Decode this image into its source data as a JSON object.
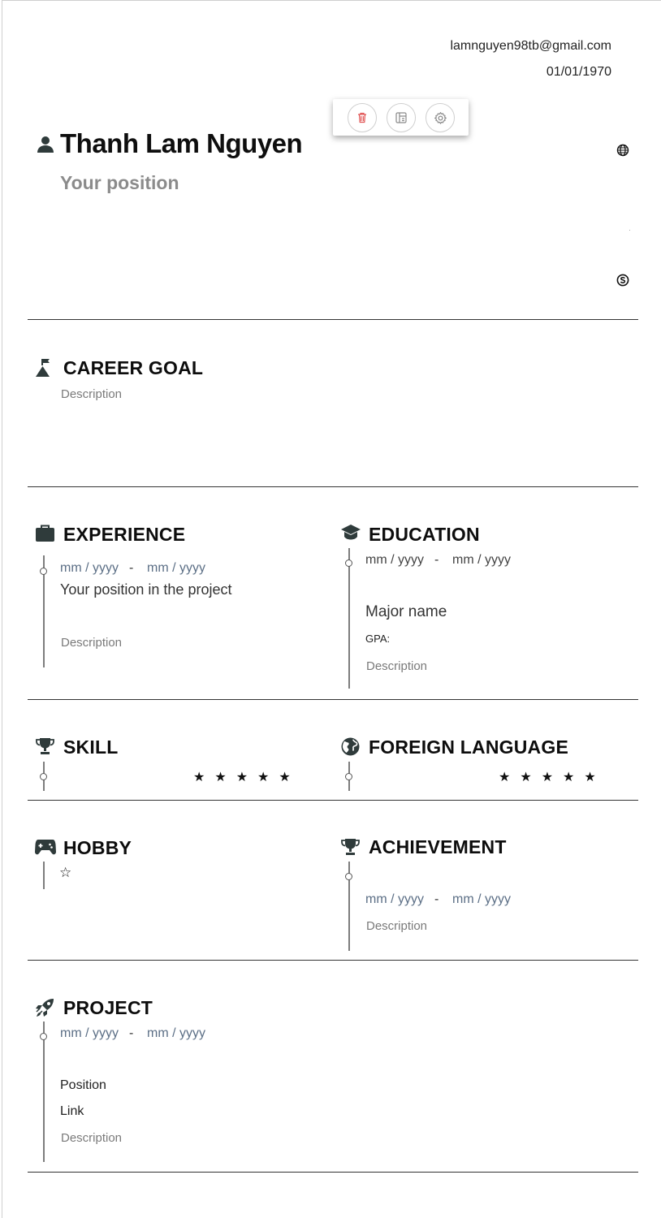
{
  "contact": {
    "email": "lamnguyen98tb@gmail.com",
    "birthday": "01/01/1970"
  },
  "profile": {
    "name": "Thanh Lam Nguyen",
    "position": "Your position"
  },
  "toolbar": {
    "icons": [
      "trash-icon",
      "layout-icon",
      "settings-icon"
    ],
    "delete_color": "#e05252"
  },
  "sections": {
    "career_goal": {
      "title": "CAREER GOAL",
      "description": "Description"
    },
    "experience": {
      "title": "EXPERIENCE",
      "start": "mm / yyyy",
      "separator": "-",
      "end": "mm / yyyy",
      "position": "Your position in the project",
      "description": "Description"
    },
    "education": {
      "title": "EDUCATION",
      "start": "mm / yyyy",
      "separator": "-",
      "end": "mm / yyyy",
      "major": "Major name",
      "gpa": "GPA:",
      "description": "Description"
    },
    "skill": {
      "title": "SKILL",
      "stars": "★★★★★"
    },
    "foreign_language": {
      "title": "FOREIGN LANGUAGE",
      "stars": "★★★★★"
    },
    "hobby": {
      "title": "HOBBY",
      "star": "☆"
    },
    "achievement": {
      "title": "ACHIEVEMENT",
      "start": "mm / yyyy",
      "separator": "-",
      "end": "mm / yyyy",
      "description": "Description"
    },
    "project": {
      "title": "PROJECT",
      "start": "mm / yyyy",
      "separator": "-",
      "end": "mm / yyyy",
      "position": "Position",
      "link": "Link",
      "description": "Description"
    }
  },
  "colors": {
    "icon": "#2f3b3b",
    "date": "#5c6f86",
    "accent_text": "#8b8b8b"
  }
}
